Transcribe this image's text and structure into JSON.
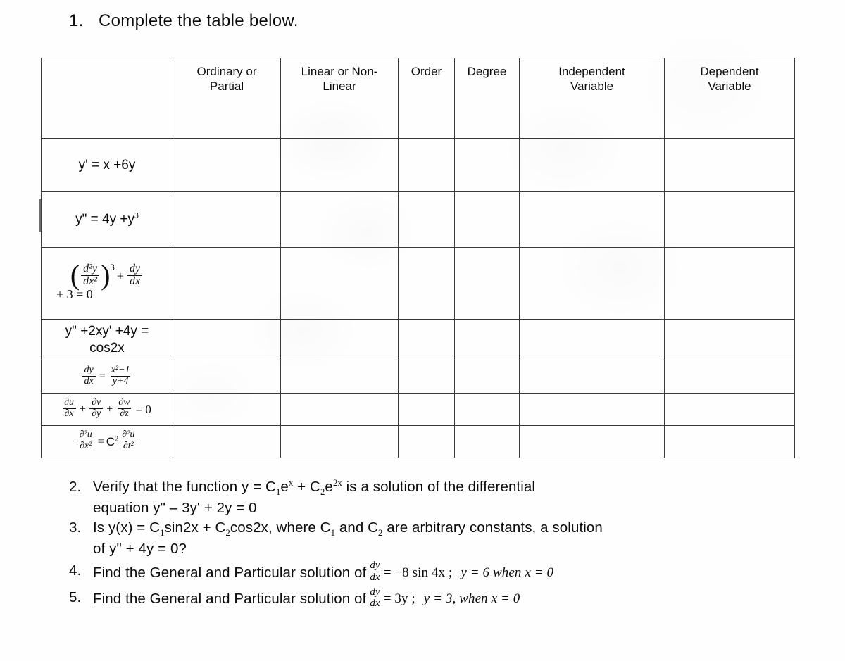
{
  "document": {
    "title_line": "Complete the table below.",
    "item1_number": "1."
  },
  "table": {
    "headers": [
      "",
      "Ordinary or Partial",
      "Linear or Non-Linear",
      "Order",
      "Degree",
      "Independent Variable",
      "Dependent Variable"
    ],
    "header_lines": {
      "h1a": "Ordinary or",
      "h1b": "Partial",
      "h2a": "Linear or Non-",
      "h2b": "Linear",
      "h3": "Order",
      "h4": "Degree",
      "h5a": "Independent",
      "h5b": "Variable",
      "h6a": "Dependent",
      "h6b": "Variable"
    },
    "rows": [
      {
        "equation_text": "y' = x +6y",
        "cells": [
          "",
          "",
          "",
          "",
          "",
          ""
        ]
      },
      {
        "equation_text": "y\" = 4y +y³",
        "cells": [
          "",
          "",
          "",
          "",
          "",
          ""
        ]
      },
      {
        "equation_text": "(d²y/dx²)³ + dy/dx + 3 = 0",
        "cells": [
          "",
          "",
          "",
          "",
          "",
          ""
        ]
      },
      {
        "equation_text": "y\" +2xy' +4y = cos2x",
        "cells": [
          "",
          "",
          "",
          "",
          "",
          ""
        ]
      },
      {
        "equation_text": "dy/dx = (x²−1)/(y+4)",
        "cells": [
          "",
          "",
          "",
          "",
          "",
          ""
        ]
      },
      {
        "equation_text": "∂u/∂x + ∂v/∂y + ∂w/∂z = 0",
        "cells": [
          "",
          "",
          "",
          "",
          "",
          ""
        ]
      },
      {
        "equation_text": "∂²u/∂x² = C²∂²u/∂t²",
        "cells": [
          "",
          "",
          "",
          "",
          "",
          ""
        ]
      }
    ],
    "row_equations": {
      "r1": {
        "y_prime": "y'",
        "eq": "= x +6y"
      },
      "r2": {
        "y_dprime": "y\"",
        "eq": "= 4y +y",
        "exp": "3"
      },
      "r3": {
        "num": "d²y",
        "den": "dx²",
        "power": "3",
        "plus": "+",
        "num2": "dy",
        "den2": "dx",
        "line2": "+ 3 = 0"
      },
      "r4": {
        "line1": "y\" +2xy' +4y =",
        "line2": "cos2x"
      },
      "r5": {
        "num1": "dy",
        "den1": "dx",
        "eq": "=",
        "num2": "x²−1",
        "den2": "y+4"
      },
      "r6": {
        "n1": "∂u",
        "d1": "∂x",
        "p1": "+",
        "n2": "∂v",
        "d2": "∂y",
        "p2": "+",
        "n3": "∂w",
        "d3": "∂z",
        "tail": "= 0"
      },
      "r7": {
        "n1": "∂²u",
        "d1": "∂x²",
        "eq": "=",
        "coef": "C",
        "coef_pow": "2",
        "n2": "∂²u",
        "d2": "∂t²"
      }
    }
  },
  "questions": [
    {
      "number": "2.",
      "line1_a": "Verify that the function y = C",
      "line1_sub1": "1",
      "line1_b": "e",
      "line1_sup1": "x",
      "line1_c": " + C",
      "line1_sub2": "2",
      "line1_d": "e",
      "line1_sup2": "2x",
      "line1_e": " is a solution of the differential",
      "line2": "equation y\" – 3y' + 2y = 0"
    },
    {
      "number": "3.",
      "line1_a": "Is y(x) = C",
      "line1_sub1": "1",
      "line1_b": "sin2x + C",
      "line1_sub2": "2",
      "line1_c": "cos2x, where C",
      "line1_sub3": "1",
      "line1_d": " and C",
      "line1_sub4": "2",
      "line1_e": " are arbitrary constants, a solution",
      "line2": "of y\" + 4y = 0?"
    },
    {
      "number": "4.",
      "text_a": "Find the General and Particular solution of",
      "frac_num": "dy",
      "frac_den": "dx",
      "text_b": "= −8 sin 4x  ;",
      "text_c": "y = 6 when x = 0"
    },
    {
      "number": "5.",
      "text_a": "Find the General and Particular solution of",
      "frac_num": "dy",
      "frac_den": "dx",
      "text_b": "= 3y  ;",
      "text_c": "y = 3, when x = 0"
    }
  ],
  "colors": {
    "text": "#0b0b0b",
    "border": "#3a3a3a",
    "background": "#fefefe"
  }
}
